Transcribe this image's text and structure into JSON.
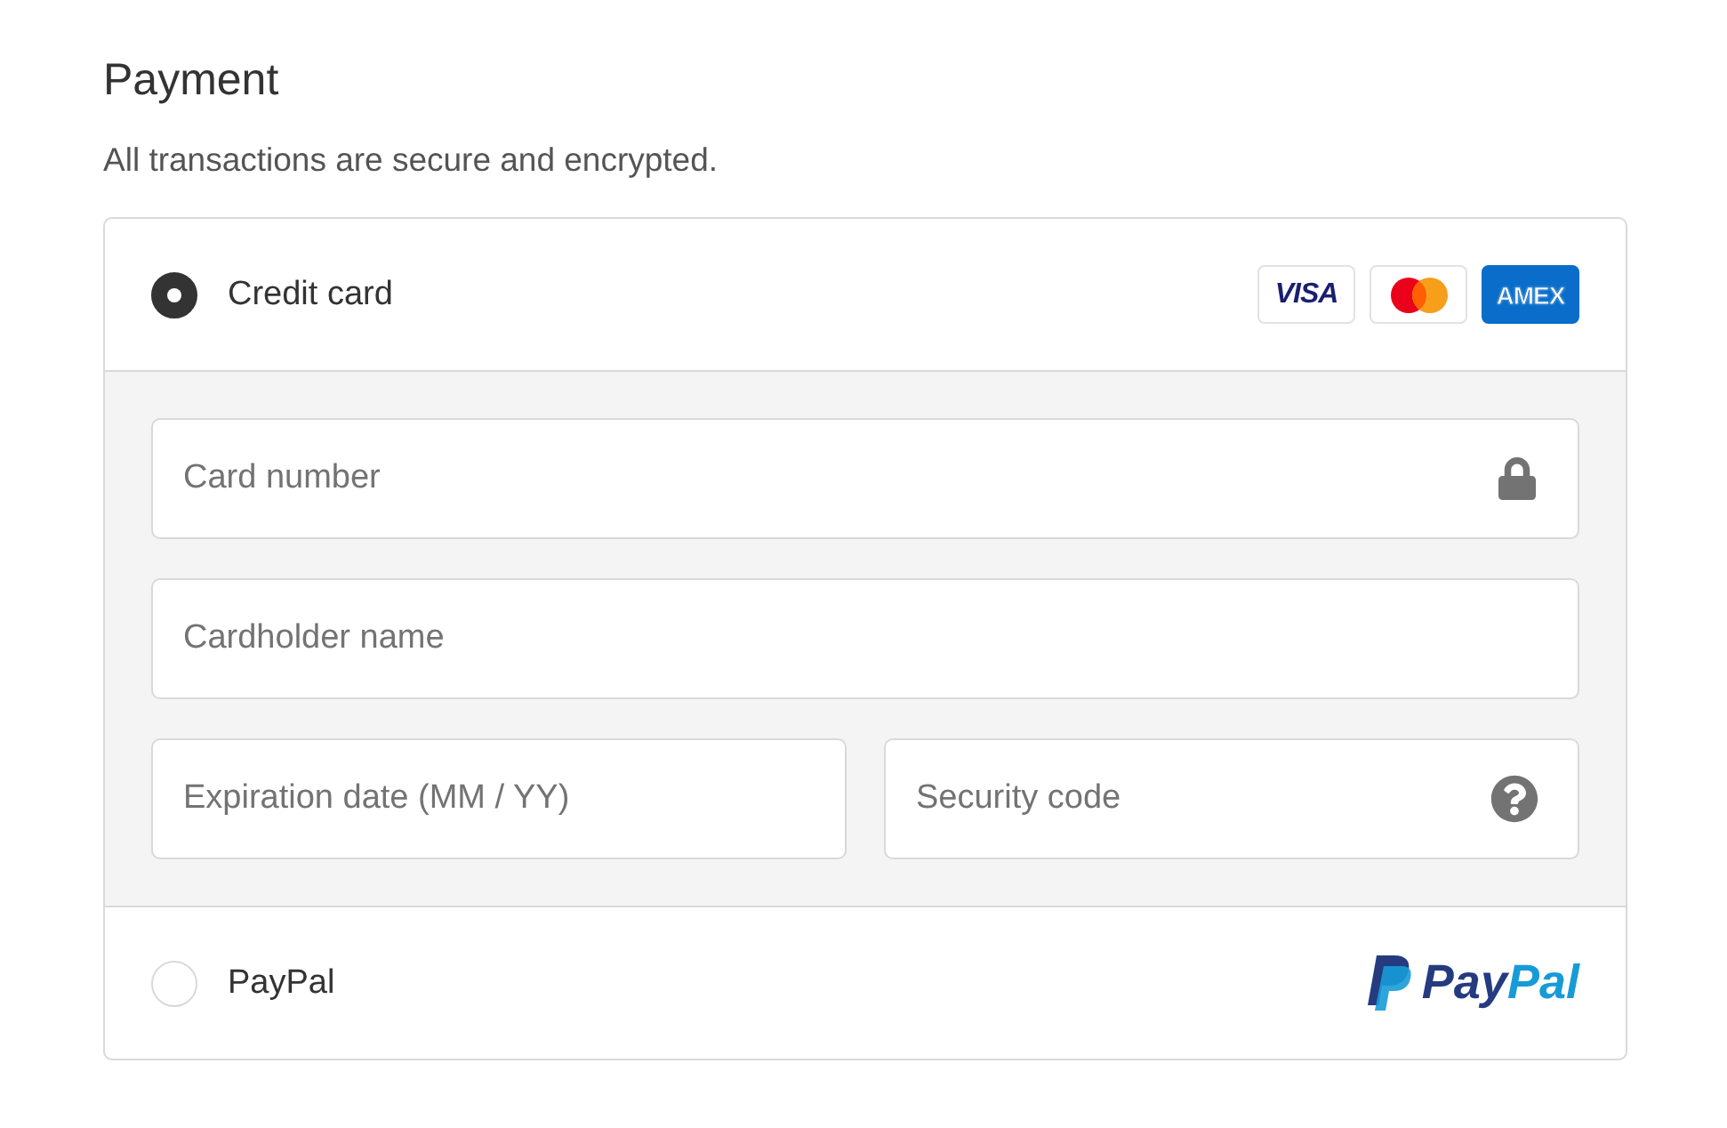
{
  "title": "Payment",
  "subtitle": "All transactions are secure and encrypted.",
  "methods": [
    {
      "kind": "card",
      "label": "Credit card",
      "selected": true,
      "logos": [
        {
          "kind": "visa",
          "text": "VISA"
        },
        {
          "kind": "mastercard"
        },
        {
          "kind": "amex",
          "text": "AMEX"
        }
      ],
      "fields": [
        {
          "placeholder": "Card number"
        },
        {
          "placeholder": "Cardholder name"
        },
        {
          "placeholder": "Expiration date (MM / YY)"
        },
        {
          "placeholder": "Security code"
        }
      ]
    },
    {
      "kind": "paypal",
      "label": "PayPal",
      "selected": false,
      "logo_parts": [
        "Pay",
        "Pal"
      ]
    }
  ]
}
